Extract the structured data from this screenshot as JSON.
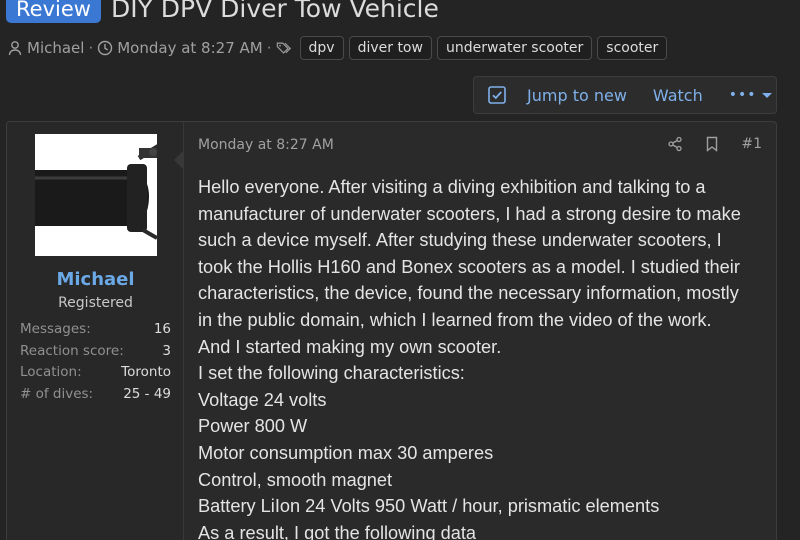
{
  "thread": {
    "prefix": "Review",
    "title": "DIY DPV Diver Tow Vehicle",
    "author": "Michael",
    "date": "Monday at 8:27 AM",
    "tags": [
      "dpv",
      "diver tow",
      "underwater scooter",
      "scooter"
    ]
  },
  "buttons": {
    "jump": "Jump to new",
    "watch": "Watch",
    "more": "•••"
  },
  "post": {
    "user": {
      "name": "Michael",
      "title": "Registered",
      "stats": [
        {
          "key": "Messages:",
          "value": "16"
        },
        {
          "key": "Reaction score:",
          "value": "3"
        },
        {
          "key": "Location:",
          "value": "Toronto"
        },
        {
          "key": "# of dives:",
          "value": "25 - 49"
        }
      ]
    },
    "date": "Monday at 8:27 AM",
    "number": "#1",
    "lines": [
      "Hello everyone. After visiting a diving exhibition and talking to a",
      "manufacturer of underwater scooters, I had a strong desire to make",
      "such a device myself. After studying these underwater scooters, I",
      "took the Hollis H160 and Bonex scooters as a model. I studied their",
      "characteristics, the device, found the necessary information, mostly",
      "in the public domain, which I learned from the video of the work.",
      "And I started making my own scooter.",
      "I set the following characteristics:",
      "Voltage 24 volts",
      "Power 800 W",
      "Motor consumption max 30 amperes",
      "Control, smooth magnet",
      "Battery LiIon 24 Volts 950 Watt / hour, prismatic elements",
      "As a result, I got the following data"
    ]
  },
  "colors": {
    "background": "#242424",
    "accent": "#3a78d4",
    "link": "#7fb0ea",
    "username": "#6aa8e6"
  }
}
